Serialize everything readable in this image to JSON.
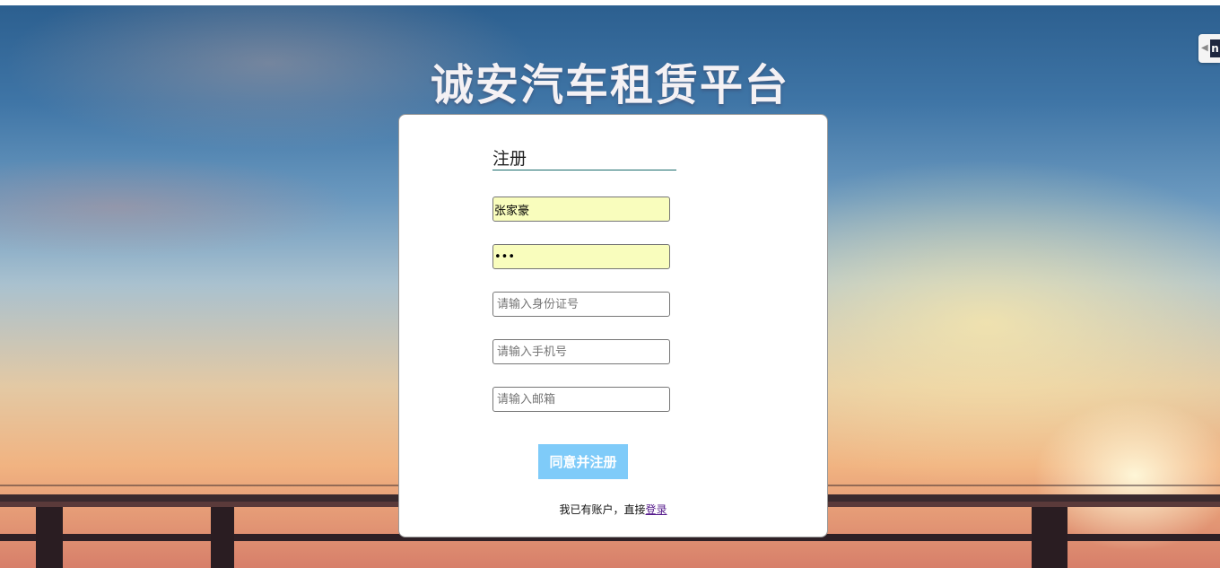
{
  "page": {
    "title": "诚安汽车租赁平台"
  },
  "form": {
    "heading": "注册",
    "username_value": "张家豪",
    "password_value": "•••",
    "id_placeholder": "请输入身份证号",
    "phone_placeholder": "请输入手机号",
    "email_placeholder": "请输入邮箱",
    "submit_label": "同意并注册",
    "footer_text": "我已有账户，直接",
    "login_link": "登录"
  },
  "colors": {
    "submit_bg": "#7fcbf9",
    "autofill_bg": "#f9fdbd",
    "heading_underline": "#1a6b6b",
    "link": "#551a8b"
  }
}
